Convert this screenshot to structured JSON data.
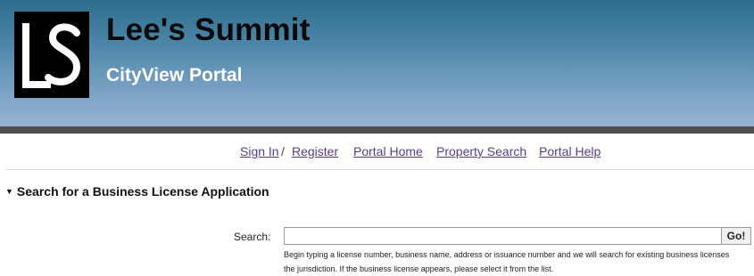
{
  "header": {
    "logo_text": "LS",
    "site_title": "Lee's Summit",
    "site_subtitle": "CityView Portal"
  },
  "nav": {
    "sign_in": "Sign In",
    "separator": "/",
    "register": "Register",
    "portal_home": "Portal Home",
    "property_search": "Property Search",
    "portal_help": "Portal Help"
  },
  "section": {
    "title": "Search for a Business License Application",
    "toggle_glyph": "▼"
  },
  "search": {
    "label": "Search:",
    "value": "",
    "placeholder": "",
    "button_label": "Go!",
    "help_line1": "Begin typing a license number, business name, address or issuance number and we will search for existing business licenses",
    "help_line2": "the jurisdiction. If the business license appears, please select it from the list."
  },
  "colors": {
    "header_gradient_top": "#2e6d8c",
    "header_gradient_bottom": "#96b4d2",
    "header_bar": "#505050",
    "link": "#5a3d8a"
  }
}
